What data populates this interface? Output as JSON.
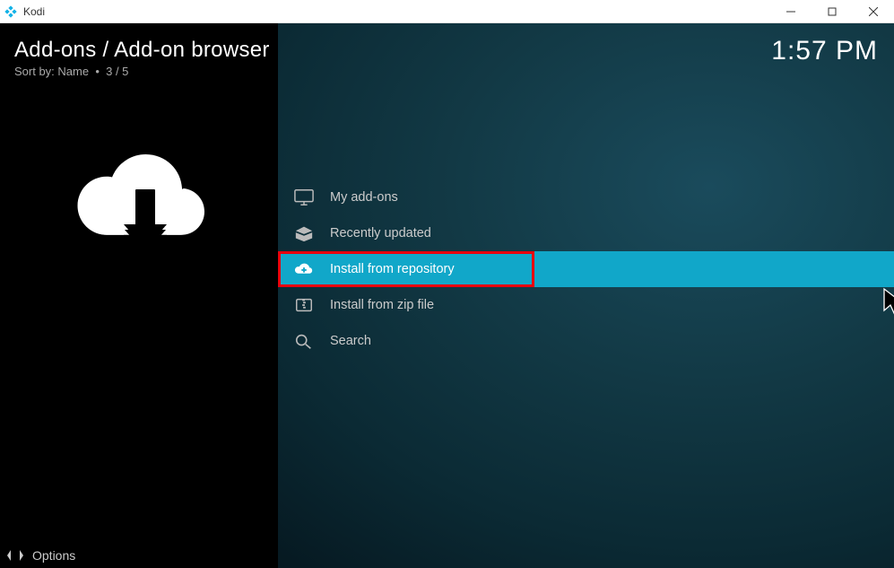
{
  "window": {
    "title": "Kodi"
  },
  "header": {
    "breadcrumb": "Add-ons / Add-on browser",
    "sort_label": "Sort by: Name",
    "position": "3 / 5",
    "clock": "1:57 PM"
  },
  "menu": {
    "items": [
      {
        "label": "My add-ons",
        "icon": "monitor-icon"
      },
      {
        "label": "Recently updated",
        "icon": "box-open-icon"
      },
      {
        "label": "Install from repository",
        "icon": "cloud-plus-icon"
      },
      {
        "label": "Install from zip file",
        "icon": "zip-file-icon"
      },
      {
        "label": "Search",
        "icon": "search-icon"
      }
    ]
  },
  "footer": {
    "options_label": "Options"
  }
}
